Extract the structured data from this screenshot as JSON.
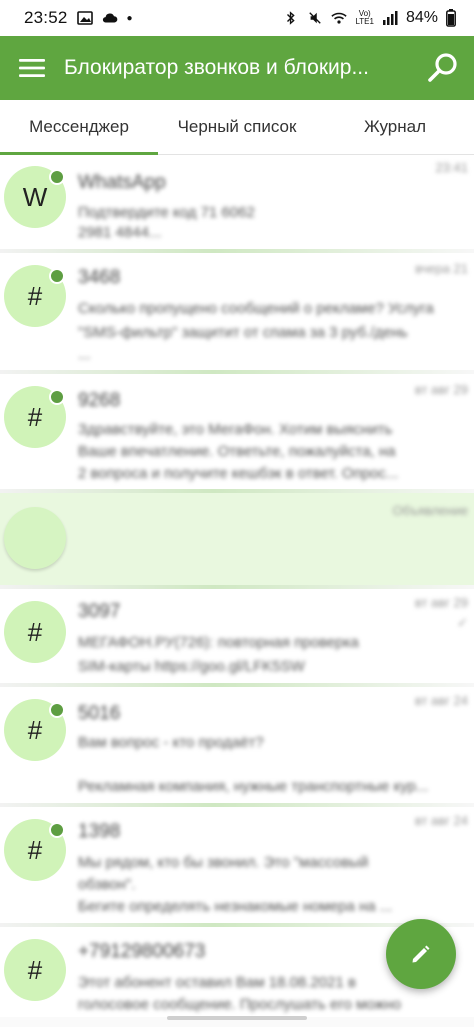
{
  "status_bar": {
    "time": "23:52",
    "battery": "84%",
    "icons": [
      "image-icon",
      "cloud-icon",
      "dot-icon",
      "bluetooth-icon",
      "mute-icon",
      "wifi-icon",
      "lte-icon",
      "signal-icon",
      "battery-icon"
    ]
  },
  "app_bar": {
    "title": "Блокиратор звонков и блокир...",
    "menu_icon": "menu-icon",
    "search_icon": "search-icon"
  },
  "tabs": [
    {
      "label": "Мессенджер",
      "active": true
    },
    {
      "label": "Черный список",
      "active": false
    },
    {
      "label": "Журнал",
      "active": false
    }
  ],
  "messages": [
    {
      "avatar": "W",
      "unread": true,
      "name": "WhatsApp",
      "time": "23:41",
      "lines": [
        "Подтвердите код 71 6062",
        "2981 4844..."
      ]
    },
    {
      "avatar": "#",
      "unread": true,
      "name": "3468",
      "time": "вчера 21",
      "lines": [
        "Сколько пропущено сообщений о рекламе? Услуга",
        "\"SMS-фильтр\" защитит от спама за 3 руб./день",
        "..."
      ]
    },
    {
      "avatar": "#",
      "unread": true,
      "name": "9268",
      "time": "вт авг 29",
      "lines": [
        "Здравствуйте, это МегаФон. Хотим выяснить",
        "Ваше впечатление. Ответьте, пожалуйста, на",
        "2 вопроса и получите кешбэк в ответ. Опрос..."
      ]
    },
    {
      "avatar": "",
      "unread": false,
      "name": "",
      "time": "Объявление",
      "lines": []
    },
    {
      "avatar": "#",
      "unread": false,
      "name": "3097",
      "time": "вт авг 29",
      "lines": [
        "МЕГАФОН.РУ(726): повторная проверка",
        "SIM-карты https://goo.gl/LFK5SW"
      ]
    },
    {
      "avatar": "#",
      "unread": true,
      "name": "5016",
      "time": "вт авг 24",
      "lines": [
        "Вам вопрос - кто продаёт?",
        "",
        "Рекламная компания, нужные транспортные кур..."
      ]
    },
    {
      "avatar": "#",
      "unread": true,
      "name": "1398",
      "time": "вт авг 24",
      "lines": [
        "Мы рядом, кто бы звонил. Это \"массовый",
        "обзвон\".",
        "Бегите определять незнакомые номера на ..."
      ]
    },
    {
      "avatar": "#",
      "unread": false,
      "name": "+79129800673",
      "time": "",
      "lines": [
        "Этот абонент оставил Вам 18.08.2021 в",
        "голосовое сообщение. Прослушать его можно"
      ]
    }
  ],
  "fab": {
    "icon": "pencil-icon"
  }
}
